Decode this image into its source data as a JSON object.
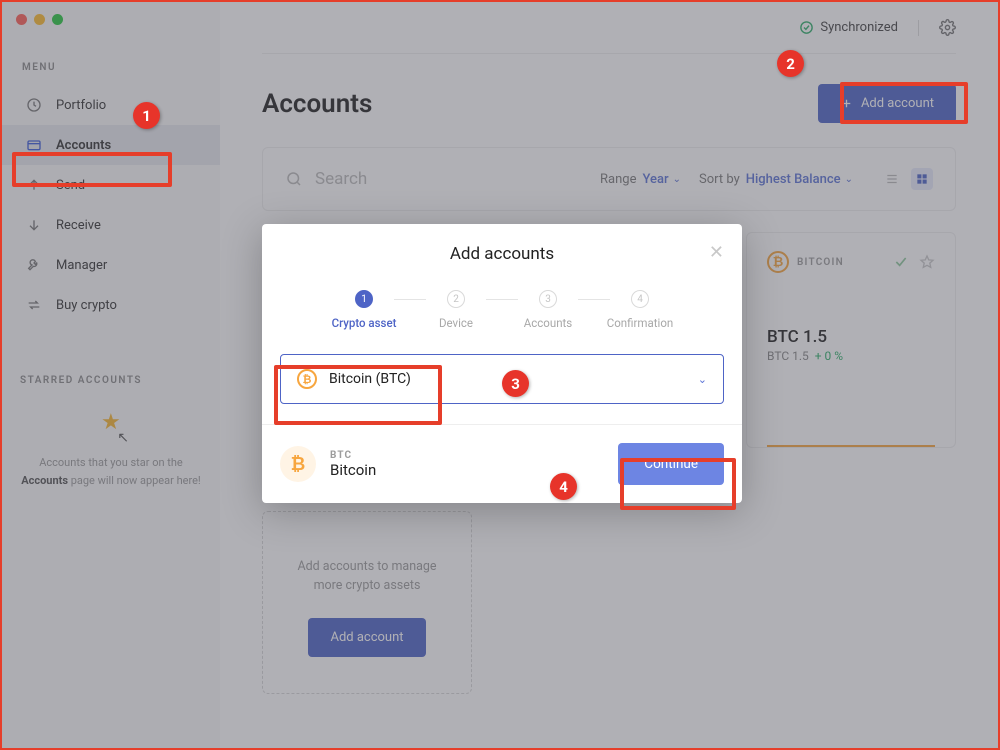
{
  "sidebar": {
    "menu_heading": "MENU",
    "items": [
      {
        "label": "Portfolio"
      },
      {
        "label": "Accounts"
      },
      {
        "label": "Send"
      },
      {
        "label": "Receive"
      },
      {
        "label": "Manager"
      },
      {
        "label": "Buy crypto"
      }
    ],
    "starred_heading": "STARRED ACCOUNTS",
    "starred_hint_pre": "Accounts that you star on the ",
    "starred_hint_bold": "Accounts",
    "starred_hint_post": " page will now appear here!"
  },
  "topbar": {
    "sync_label": "Synchronized"
  },
  "page": {
    "title": "Accounts",
    "add_account_label": "Add account"
  },
  "toolbar": {
    "search_placeholder": "Search",
    "range_label": "Range",
    "range_value": "Year",
    "sort_label": "Sort by",
    "sort_value": "Highest Balance"
  },
  "dashed_card": {
    "hint": "Add accounts to manage more crypto assets",
    "button": "Add account"
  },
  "btc_card": {
    "name": "BITCOIN",
    "amount_big": "BTC 1.5",
    "amount_small": "BTC 1.5",
    "delta": "+ 0 %"
  },
  "modal": {
    "title": "Add accounts",
    "steps": [
      "Crypto asset",
      "Device",
      "Accounts",
      "Confirmation"
    ],
    "selected_asset": "Bitcoin (BTC)",
    "footer_ticker": "BTC",
    "footer_name": "Bitcoin",
    "continue": "Continue"
  },
  "annotations": {
    "n1": "1",
    "n2": "2",
    "n3": "3",
    "n4": "4"
  }
}
